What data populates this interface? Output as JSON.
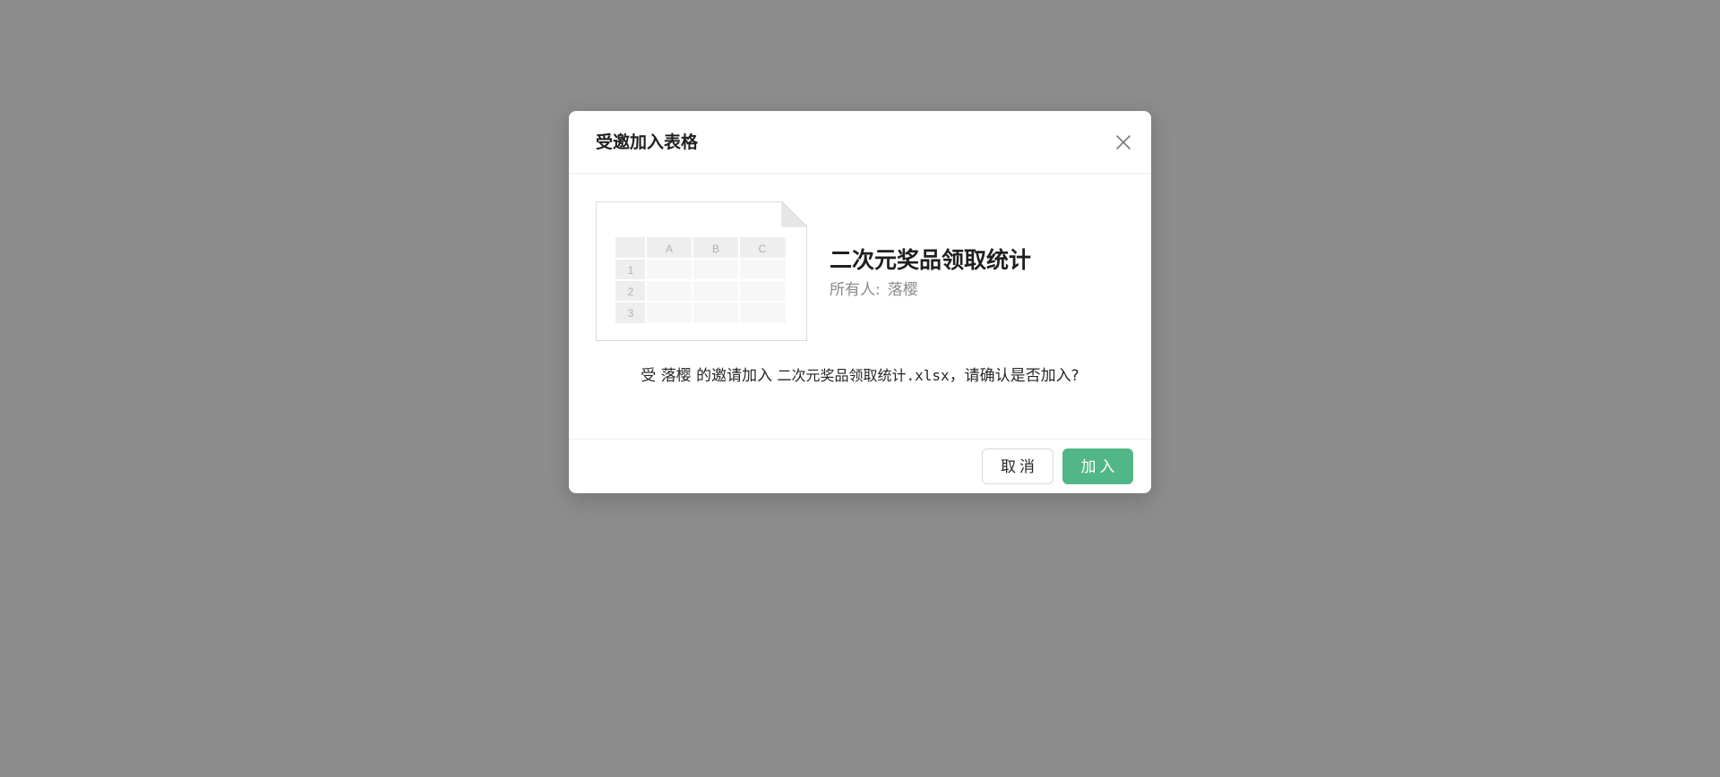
{
  "dialog": {
    "title": "受邀加入表格",
    "close_icon": "close-icon"
  },
  "file": {
    "name": "二次元奖品领取统计",
    "owner_label": "所有人:",
    "owner_name": "落樱",
    "thumbnail": {
      "columns": [
        "A",
        "B",
        "C"
      ],
      "rows": [
        "1",
        "2",
        "3"
      ]
    }
  },
  "message": {
    "prefix": "受 ",
    "inviter": "落樱",
    "middle": " 的邀请加入 ",
    "filename_cn": "二次元奖品领取统计",
    "filename_ext": ".xlsx",
    "suffix": "，请确认是否加入?"
  },
  "footer": {
    "cancel_label": "取消",
    "join_label": "加入"
  },
  "colors": {
    "overlay": "#8c8c8c",
    "primary": "#52b788"
  }
}
